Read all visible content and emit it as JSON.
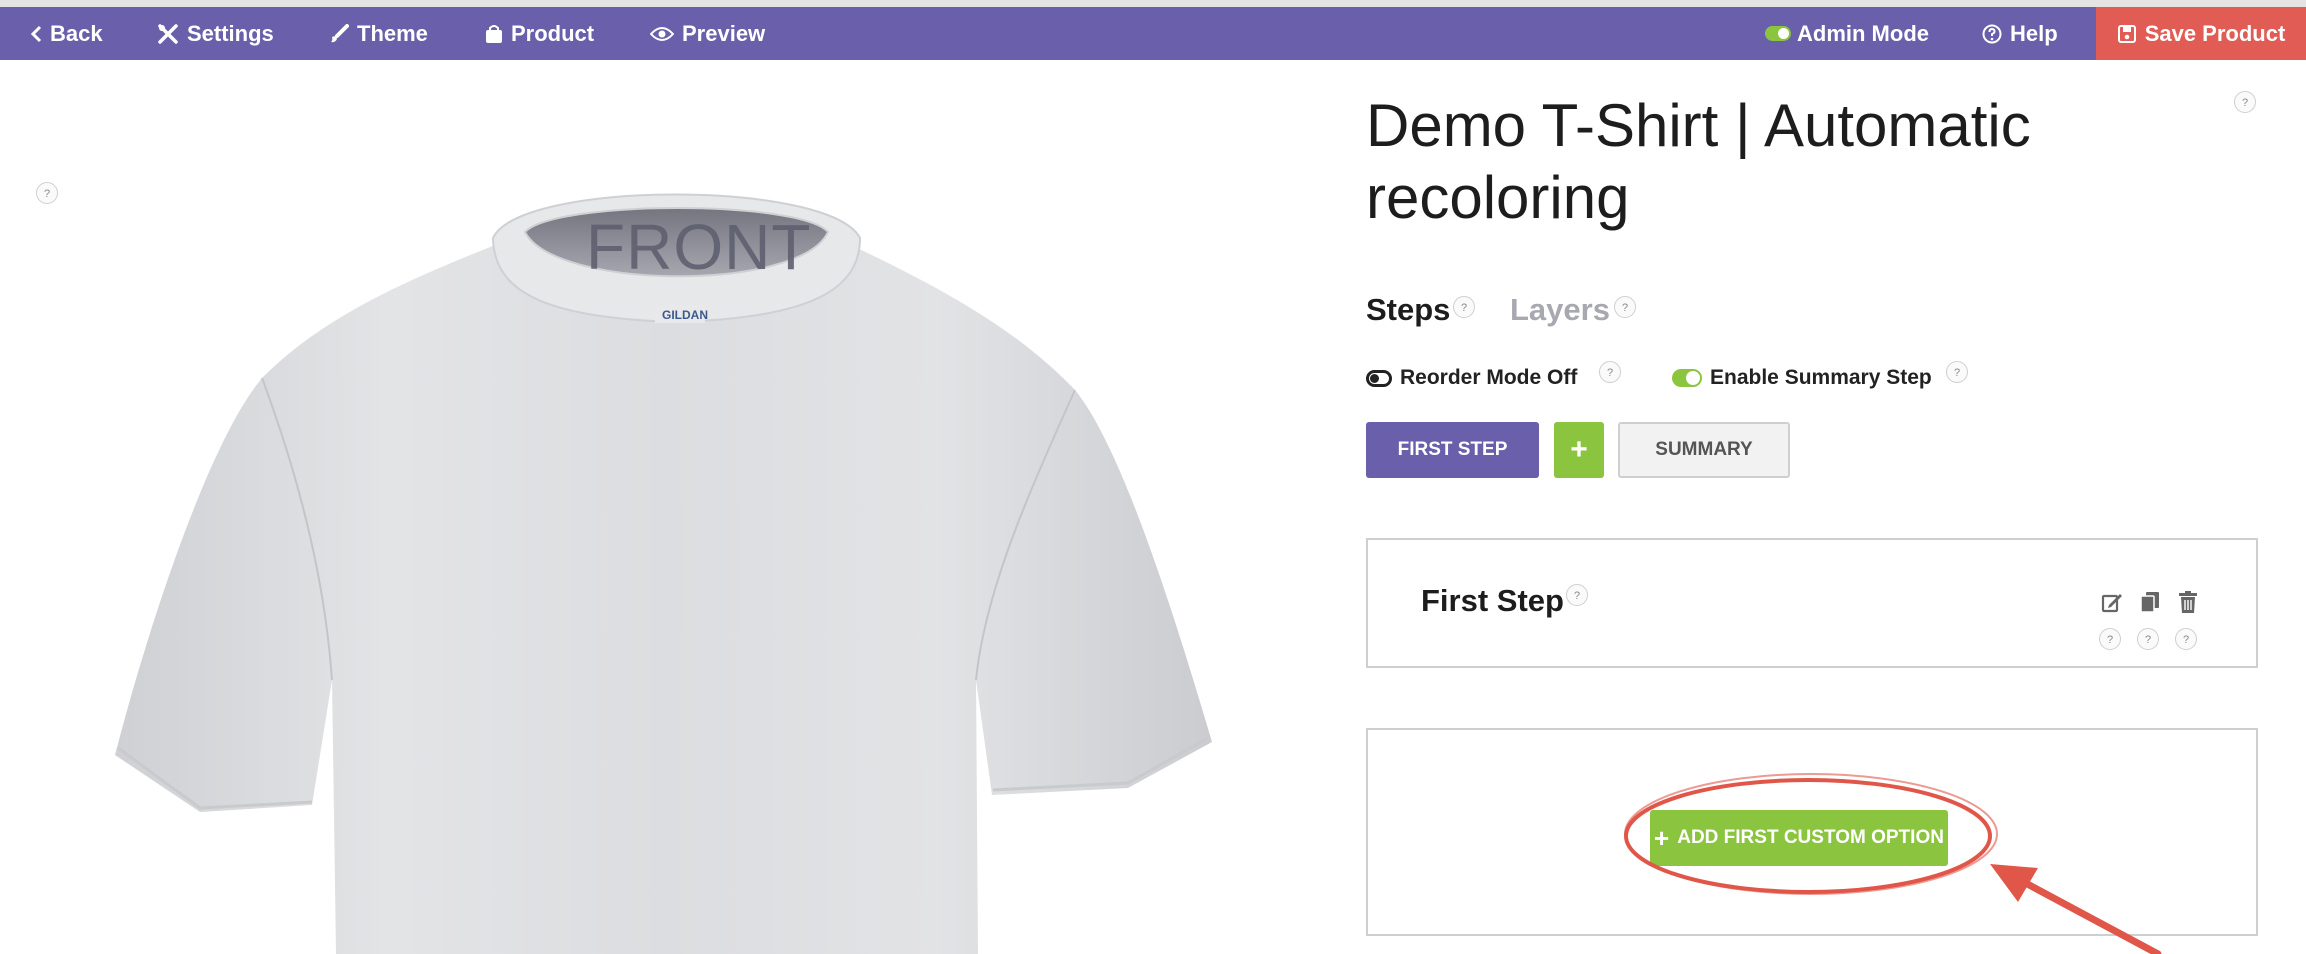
{
  "navbar": {
    "back": "Back",
    "settings": "Settings",
    "theme": "Theme",
    "product": "Product",
    "preview": "Preview",
    "admin_mode": "Admin Mode",
    "help": "Help",
    "save": "Save Product"
  },
  "preview": {
    "view_label": "FRONT",
    "collar_tag": "GILDAN"
  },
  "product": {
    "title": "Demo T-Shirt | Automatic recoloring"
  },
  "tabs": {
    "steps": "Steps",
    "layers": "Layers"
  },
  "switches": {
    "reorder": "Reorder Mode Off",
    "summary": "Enable Summary Step"
  },
  "step_buttons": {
    "first": "FIRST STEP",
    "add": "+",
    "summary": "SUMMARY"
  },
  "step_panel": {
    "title": "First Step"
  },
  "options_panel": {
    "add_option": "ADD FIRST CUSTOM OPTION",
    "add_symbol": "+"
  },
  "help_marker": "?",
  "colors": {
    "navbar": "#6a5fab",
    "save": "#e05c54",
    "green": "#8bc43f",
    "annotation": "#e0574a"
  }
}
